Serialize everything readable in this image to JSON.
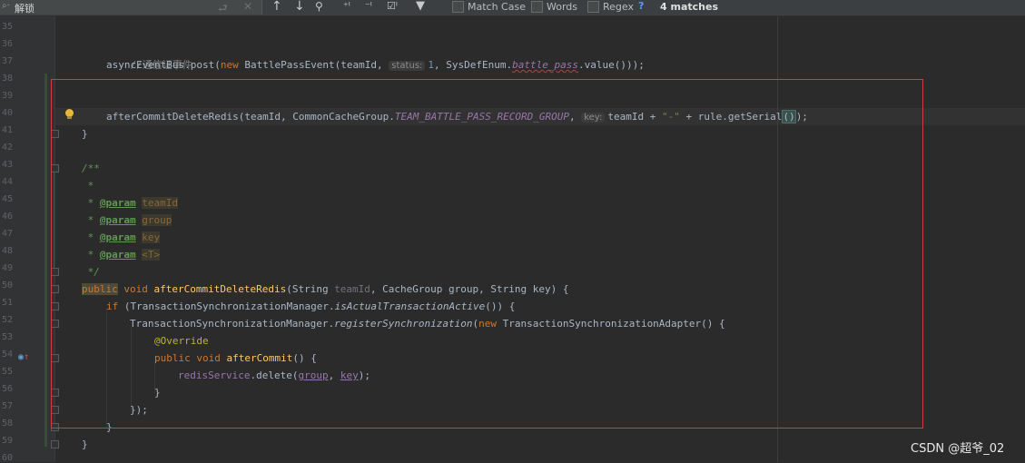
{
  "findbar": {
    "search_value": "解锁",
    "match_case": "Match Case",
    "words": "Words",
    "regex": "Regex",
    "help": "?",
    "matches": "4 matches",
    "icons": [
      "search-icon",
      "newline-icon",
      "clear-icon",
      "prev-occurrence-icon",
      "next-occurrence-icon",
      "find-all-icon",
      "add-selection-icon",
      "remove-selection-icon",
      "select-all-occurrences-icon",
      "filter-icon"
    ]
  },
  "line_numbers": [
    "35",
    "36",
    "37",
    "38",
    "39",
    "40",
    "41",
    "42",
    "43",
    "44",
    "45",
    "46",
    "47",
    "48",
    "49",
    "50",
    "51",
    "52",
    "53",
    "54",
    "55",
    "56",
    "57",
    "58",
    "59",
    "60"
  ],
  "code": {
    "l36": "//通信证事件",
    "l37_a": "asyncEventBus.post(",
    "l37_new": "new",
    "l37_b": " BattlePassEvent(teamId, ",
    "l37_hint": "status:",
    "l37_num": "1",
    "l37_c": ", SysDefEnum.",
    "l37_field": "battle_pass",
    "l37_d": ".value()));",
    "l40_a": "afterCommitDeleteRedis(teamId, CommonCacheGroup.",
    "l40_const": "TEAM_BATTLE_PASS_RECORD_GROUP",
    "l40_b": ", ",
    "l40_hint": "key:",
    "l40_c": "teamId + ",
    "l40_str": "\"-\"",
    "l40_d": " + rule.getSerial",
    "l40_paren": "()",
    "l40_e": ");",
    "l41": "}",
    "l43": "/**",
    "l44": " *",
    "l45_tag": "@param",
    "l45_p": "teamId",
    "l46_tag": "@param",
    "l46_p": "group",
    "l47_tag": "@param",
    "l47_p": "key",
    "l48_tag": "@param",
    "l48_p": "<T>",
    "l49": " */",
    "l50_pub": "public",
    "l50_void": " void ",
    "l50_fn": "afterCommitDeleteRedis",
    "l50_a": "(String ",
    "l50_dim": "teamId",
    "l50_b": ", CacheGroup group, String key) {",
    "l51_if": "if",
    "l51_a": " (TransactionSynchronizationManager.",
    "l51_ital": "isActualTransactionActive",
    "l51_b": "()) {",
    "l52_a": "TransactionSynchronizationManager.",
    "l52_ital": "registerSynchronization",
    "l52_b": "(",
    "l52_new": "new",
    "l52_c": " TransactionSynchronizationAdapter() {",
    "l53_ann": "@Override",
    "l54_pub": "public void ",
    "l54_fn": "afterCommit",
    "l54_a": "() {",
    "l55_fld": "redisService",
    "l55_a": ".delete(",
    "l55_g": "group",
    "l55_b": ", ",
    "l55_k": "key",
    "l55_c": ");",
    "l56": "}",
    "l57": "});",
    "l58": "}",
    "l59": "}"
  },
  "watermark": "CSDN @超爷_02"
}
